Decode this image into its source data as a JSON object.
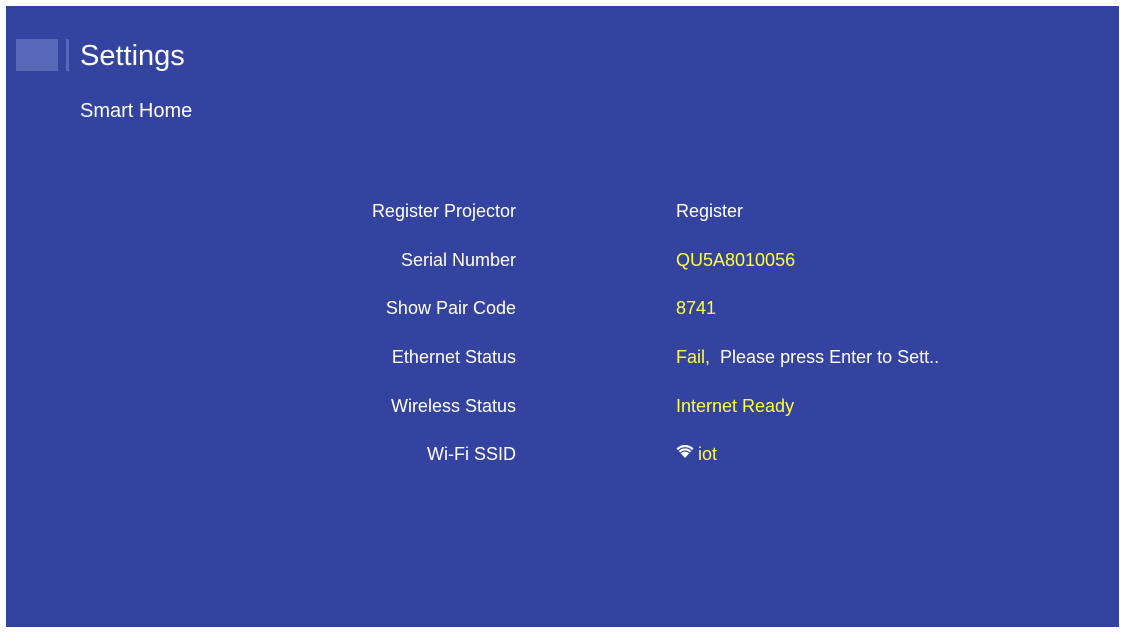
{
  "header": {
    "title": "Settings",
    "subtitle": "Smart Home"
  },
  "rows": [
    {
      "label": "Register Projector",
      "value": "Register"
    },
    {
      "label": "Serial Number",
      "value": "QU5A8010056"
    },
    {
      "label": "Show Pair Code",
      "value": "8741"
    },
    {
      "label": "Ethernet Status",
      "value_status": "Fail,",
      "value_message": "Please press Enter to Sett.."
    },
    {
      "label": "Wireless Status",
      "value": "Internet Ready"
    },
    {
      "label": "Wi-Fi SSID",
      "value": "iot",
      "icon": "wifi-icon"
    }
  ],
  "colors": {
    "background": "#33439f",
    "highlight_text": "#ffff3a",
    "text": "#ffffff"
  }
}
